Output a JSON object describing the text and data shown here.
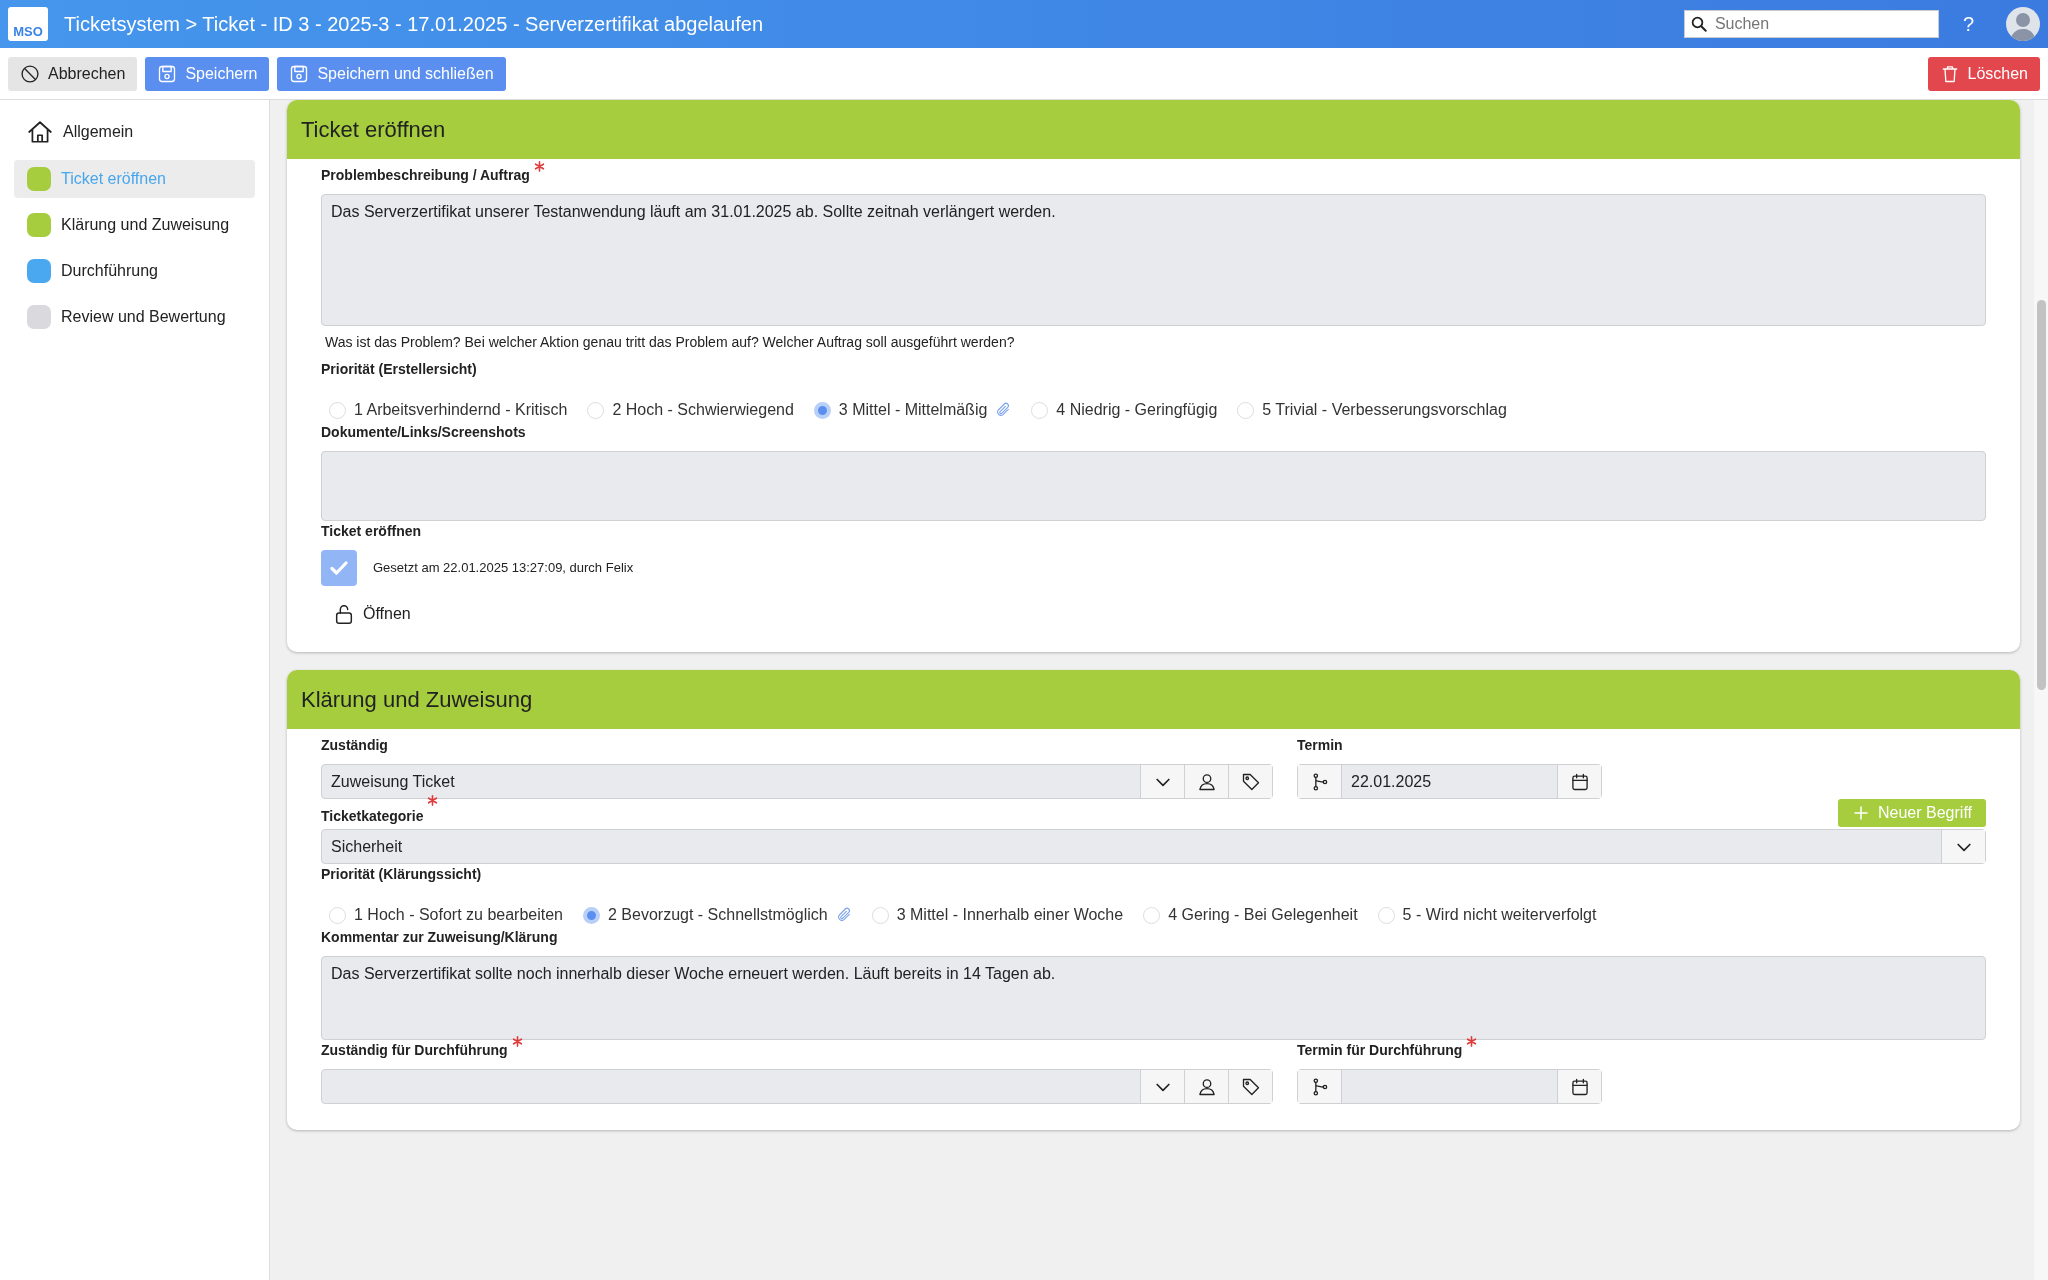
{
  "header": {
    "logo": "MSO",
    "title": "Ticketsystem > Ticket - ID 3 - 2025-3 - 17.01.2025 - Serverzertifikat abgelaufen",
    "search_placeholder": "Suchen",
    "help": "?"
  },
  "toolbar": {
    "buttons": [
      {
        "label": "Abbrechen",
        "kind": "cancel"
      },
      {
        "label": "Speichern",
        "kind": "save"
      },
      {
        "label": "Speichern und schließen",
        "kind": "save"
      }
    ],
    "delete": "Löschen"
  },
  "sidebar": {
    "items": [
      {
        "label": "Allgemein",
        "kind": "home",
        "selected": false
      },
      {
        "label": "Ticket eröffnen",
        "kind": "step",
        "color": "#a5cd3d",
        "selected": true
      },
      {
        "label": "Klärung und Zuweisung",
        "kind": "step",
        "color": "#a5cd3d",
        "selected": false
      },
      {
        "label": "Durchführung",
        "kind": "step",
        "color": "#4aa8f0",
        "selected": false
      },
      {
        "label": "Review und Bewertung",
        "kind": "step",
        "color": "#d9d9de",
        "selected": false
      }
    ]
  },
  "sections": [
    {
      "title": "Ticket eröffnen",
      "fields": [
        {
          "kind": "textarea",
          "label": "Problembeschreibung / Auftrag",
          "required": true,
          "value": "Das Serverzertifikat unserer Testanwendung läuft am 31.01.2025 ab. Sollte zeitnah verlängert werden.",
          "hint": "Was ist das Problem? Bei welcher Aktion genau tritt das Problem auf? Welcher Auftrag soll ausgeführt werden?",
          "tall": true
        },
        {
          "kind": "radio",
          "label": "Priorität (Erstellersicht)",
          "options": [
            {
              "label": "1 Arbeitsverhindernd - Kritisch",
              "selected": false
            },
            {
              "label": "2 Hoch - Schwierwiegend",
              "selected": false
            },
            {
              "label": "3 Mittel - Mittelmäßig",
              "selected": true
            },
            {
              "label": "4 Niedrig - Geringfügig",
              "selected": false
            },
            {
              "label": "5 Trivial - Verbesserungsvorschlag",
              "selected": false
            }
          ]
        },
        {
          "kind": "dropzone",
          "label": "Dokumente/Links/Screenshots"
        },
        {
          "kind": "check",
          "label": "Ticket eröffnen",
          "checked": true,
          "note": "Gesetzt am 22.01.2025 13:27:09, durch Felix",
          "action": "Öffnen"
        }
      ]
    },
    {
      "title": "Klärung und Zuweisung",
      "fields": [
        {
          "kind": "pair",
          "items": [
            {
              "kind": "person",
              "label": "Zuständig",
              "value": "Zuweisung Ticket"
            },
            {
              "kind": "date",
              "label": "Termin",
              "value": "22.01.2025"
            }
          ]
        },
        {
          "kind": "select",
          "label": "Ticketkategorie",
          "required": true,
          "value": "Sicherheit",
          "button": "Neuer Begriff"
        },
        {
          "kind": "radio",
          "label": "Priorität (Klärungssicht)",
          "options": [
            {
              "label": "1 Hoch - Sofort zu bearbeiten",
              "selected": false
            },
            {
              "label": "2 Bevorzugt - Schnellstmöglich",
              "selected": true
            },
            {
              "label": "3 Mittel - Innerhalb einer Woche",
              "selected": false
            },
            {
              "label": "4 Gering - Bei Gelegenheit",
              "selected": false
            },
            {
              "label": "5 - Wird nicht weiterverfolgt",
              "selected": false
            }
          ]
        },
        {
          "kind": "textarea",
          "label": "Kommentar zur Zuweisung/Klärung",
          "value": "Das Serverzertifikat sollte noch innerhalb dieser Woche erneuert werden. Läuft bereits in 14 Tagen ab.",
          "tall": false
        },
        {
          "kind": "pair",
          "items": [
            {
              "kind": "person",
              "label": "Zuständig für Durchführung",
              "required": true
            },
            {
              "kind": "date",
              "label": "Termin für Durchführung",
              "required": true
            }
          ]
        }
      ]
    }
  ]
}
